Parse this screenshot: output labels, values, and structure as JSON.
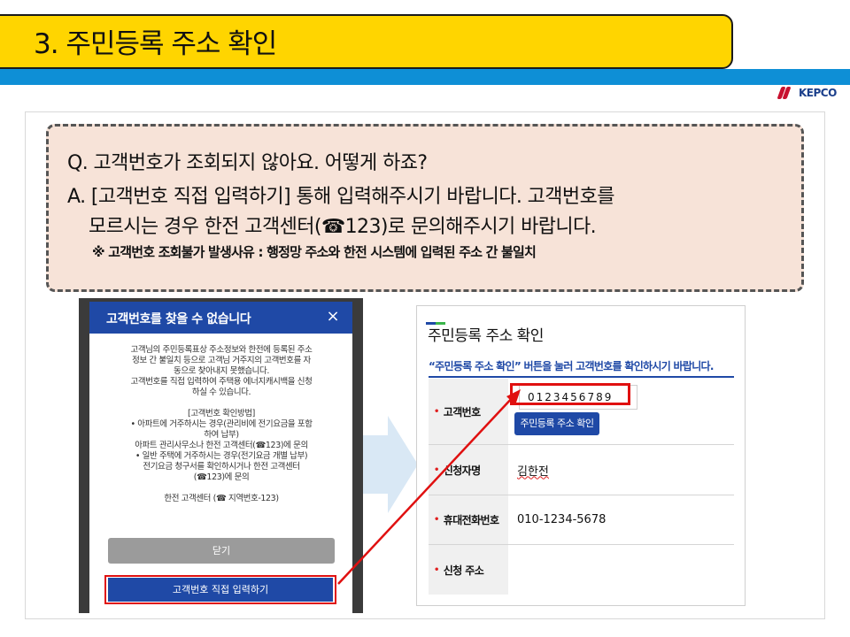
{
  "slide": {
    "title": "3. 주민등록 주소 확인",
    "logo": "KEPCO"
  },
  "faq": {
    "question": "Q. 고객번호가 조회되지 않아요. 어떻게 하죠?",
    "answer_line1": "A.  [고객번호 직접 입력하기]  통해 입력해주시기 바랍니다. 고객번호를",
    "answer_line2": "모르시는 경우 한전 고객센터(☎123)로 문의해주시기 바랍니다.",
    "note": "※ 고객번호 조회불가 발생사유 : 행정망 주소와 한전 시스템에 입력된 주소 간 불일치"
  },
  "popup": {
    "title": "고객번호를 찾을 수 없습니다",
    "close_icon": "×",
    "body_lines": [
      "고객님의 주민등록표상 주소정보와 한전에 등록된 주소",
      "정보 간 불일치 등으로 고객님 거주지의 고객번호를 자",
      "동으로 찾아내지 못했습니다.",
      "고객번호를 직접 입력하여 주택용 에너지캐시백을 신청",
      "하실 수 있습니다.",
      "",
      "[고객번호 확인방법]",
      "• 아파트에 거주하시는 경우(관리비에 전기요금을 포함",
      "하여 납부)",
      "아파트 관리사무소나 한전 고객센터(☎123)에 문의",
      "• 일반 주택에 거주하시는 경우(전기요금 개별 납부)",
      "전기요금 청구서를 확인하시거나 한전 고객센터",
      "(☎123)에 문의",
      "",
      "한전 고객센터 (☎ 지역번호-123)"
    ],
    "close_button": "닫기",
    "direct_input_button": "고객번호 직접 입력하기"
  },
  "form": {
    "title": "주민등록 주소 확인",
    "description": "“주민등록 주소 확인” 버튼을 눌러 고객번호를 확인하시기 바랍니다.",
    "customer_number_label": "고객번호",
    "customer_number_value": "0123456789",
    "confirm_button": "주민등록 주소 확인",
    "applicant_label": "신청자명",
    "applicant_value": "김한전",
    "phone_label": "휴대전화번호",
    "phone_value": "010-1234-5678",
    "address_label": "신청 주소",
    "address_value": ""
  },
  "colors": {
    "title_bar": "#ffd500",
    "header_band": "#0e8fd6",
    "faq_background": "#f7e3d8",
    "popup_header": "#1f49a6",
    "highlight_red": "#e01010",
    "arrow_light_blue": "#d9e8f5"
  }
}
